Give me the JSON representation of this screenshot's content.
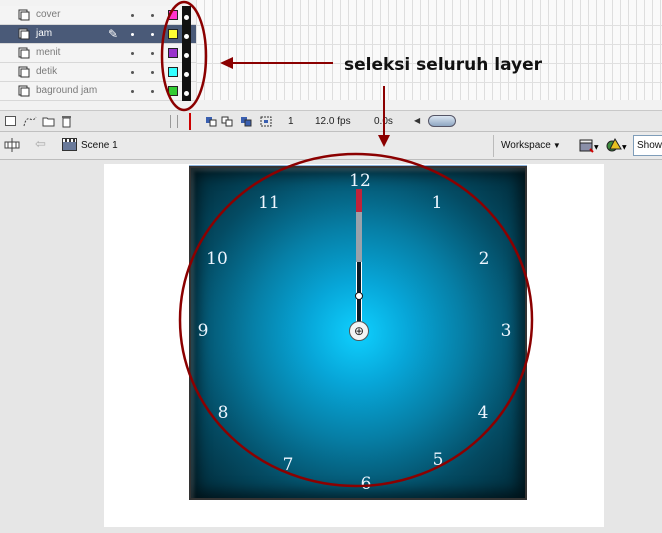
{
  "layers": [
    {
      "name": "cover",
      "color": "#ff33cc",
      "selected": false
    },
    {
      "name": "jam",
      "color": "#ffff33",
      "selected": true
    },
    {
      "name": "menit",
      "color": "#9933cc",
      "selected": false
    },
    {
      "name": "detik",
      "color": "#33ffff",
      "selected": false
    },
    {
      "name": "baground jam",
      "color": "#33cc33",
      "selected": false
    }
  ],
  "timeline_bar": {
    "current_frame": "1",
    "frame_rate": "12.0 fps",
    "elapsed_time": "0.0s"
  },
  "editbar": {
    "scene_label": "Scene 1",
    "workspace_label": "Workspace",
    "show_label": "Show"
  },
  "clock": {
    "numbers": [
      "12",
      "1",
      "2",
      "3",
      "4",
      "5",
      "6",
      "7",
      "8",
      "9",
      "10",
      "11"
    ]
  },
  "annotation": {
    "text": "seleksi seluruh layer",
    "color": "#8b0000"
  }
}
